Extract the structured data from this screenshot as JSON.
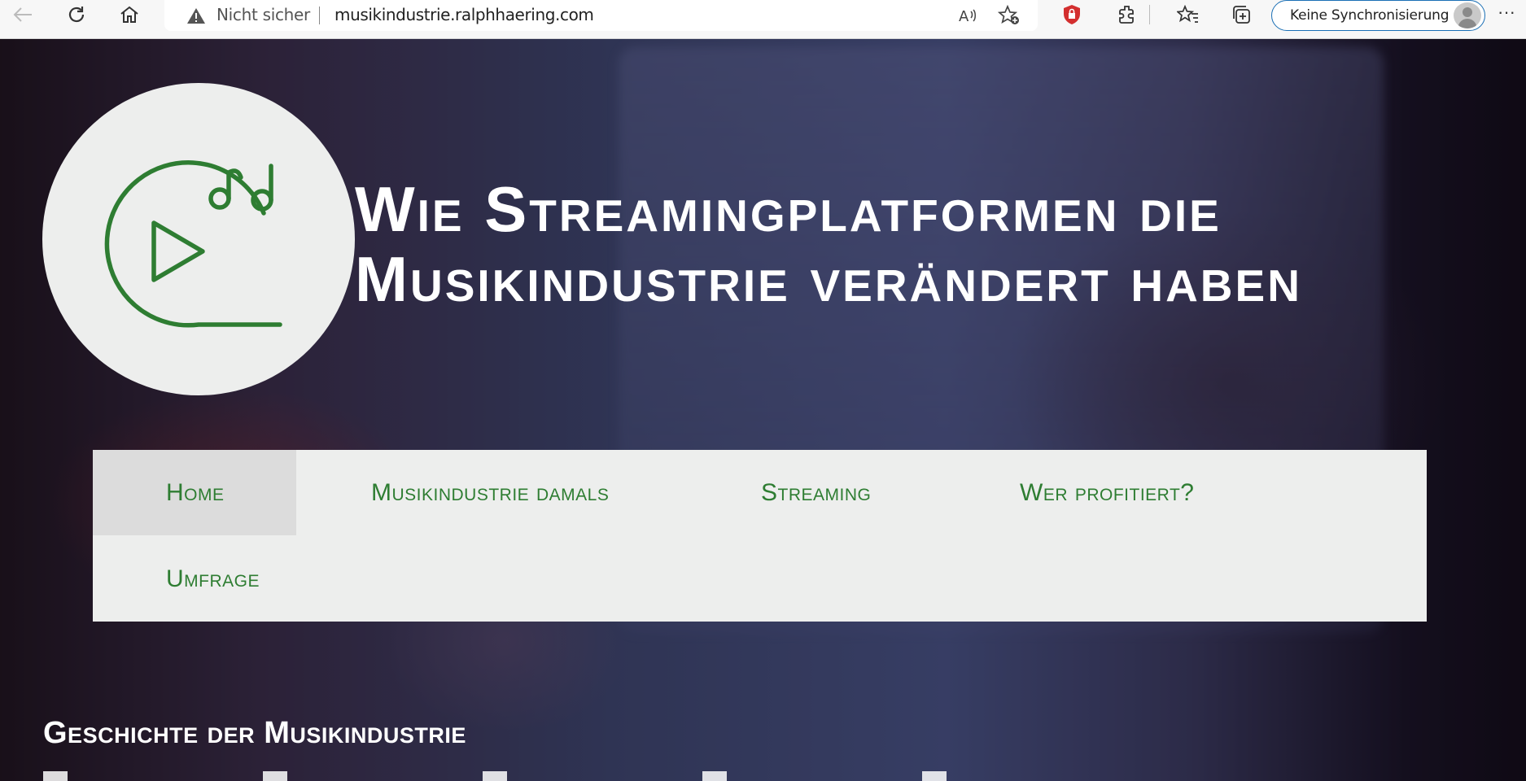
{
  "browser": {
    "address_warning": "Nicht sicher",
    "url": "musikindustrie.ralphhaering.com",
    "sync_label": "Keine Synchronisierung",
    "icons": [
      "back-icon",
      "refresh-icon",
      "home-icon",
      "warning-icon",
      "read-aloud-icon",
      "add-favorite-icon",
      "shield-extension-icon",
      "extensions-icon",
      "favorites-icon",
      "collections-icon",
      "profile-icon",
      "more-icon"
    ]
  },
  "site": {
    "title": "Wie Streamingplatformen die Musikindustrie verändert haben",
    "logo_color": "#2e7d32",
    "nav": [
      {
        "label": "Home",
        "active": true
      },
      {
        "label": "Musikindustrie damals"
      },
      {
        "label": "Streaming"
      },
      {
        "label": "Wer profitiert?"
      },
      {
        "label": "Umfrage"
      }
    ],
    "section_heading": "Geschichte der Musikindustrie"
  },
  "colors": {
    "accent_green": "#2e7d32",
    "nav_bg": "#edeeed",
    "nav_active_bg": "#dcdcdc",
    "sync_border": "#1a6fb5"
  }
}
